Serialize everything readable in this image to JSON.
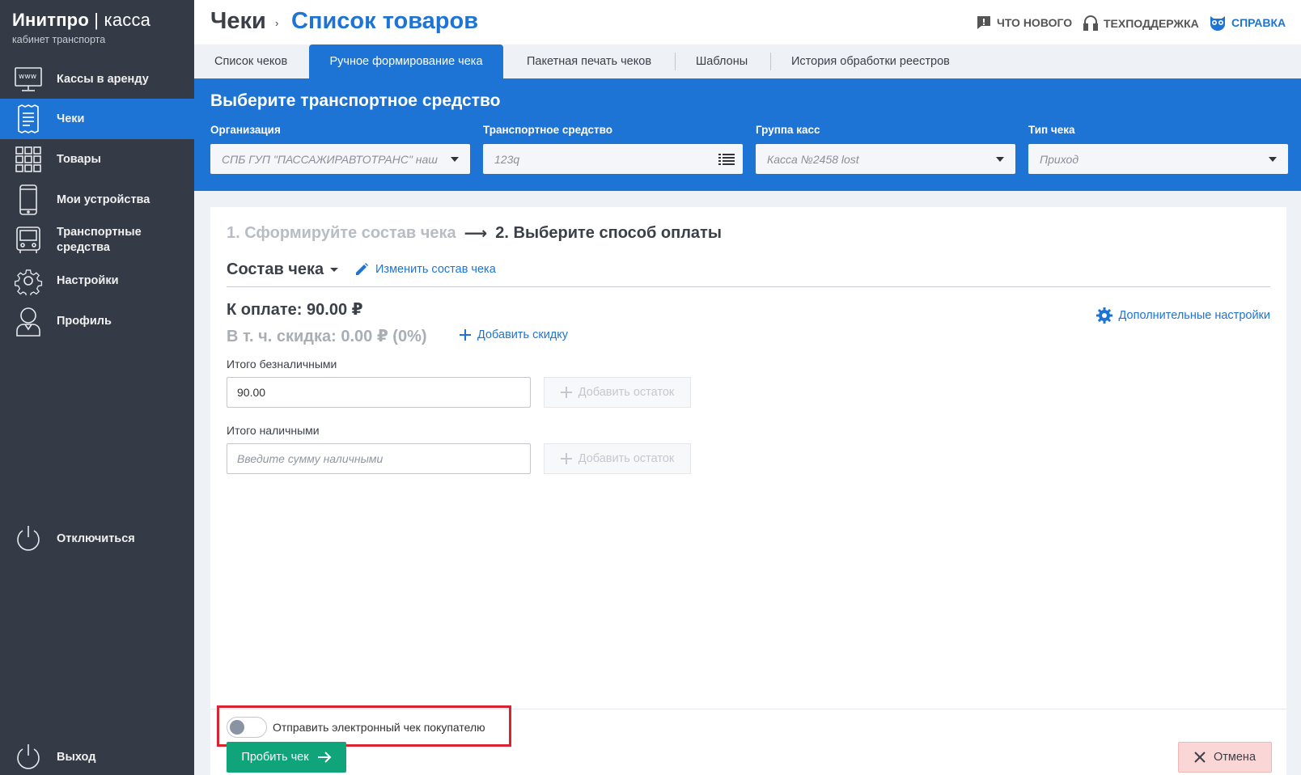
{
  "app": {
    "title_bold": "Инитпро",
    "title_sep": "|",
    "title_thin": "касса",
    "subtitle": "кабинет транспорта"
  },
  "sidebar": {
    "items": [
      {
        "label": "Кассы в аренду",
        "icon": "www-monitor-icon"
      },
      {
        "label": "Чеки",
        "icon": "receipt-icon",
        "active": true
      },
      {
        "label": "Товары",
        "icon": "grid-icon"
      },
      {
        "label": "Мои устройства",
        "icon": "phone-icon"
      },
      {
        "label": "Транспортные средства",
        "icon": "bus-icon"
      },
      {
        "label": "Настройки",
        "icon": "gear-icon"
      },
      {
        "label": "Профиль",
        "icon": "user-icon"
      }
    ],
    "disconnect": "Отключиться",
    "logout": "Выход"
  },
  "header": {
    "breadcrumb_root": "Чеки",
    "breadcrumb_sep": "›",
    "page_title": "Список товаров",
    "whats_new": "ЧТО НОВОГО",
    "support": "ТЕХПОДДЕРЖКА",
    "help": "СПРАВКА"
  },
  "tabs": [
    {
      "label": "Список чеков"
    },
    {
      "label": "Ручное формирование чека",
      "active": true
    },
    {
      "label": "Пакетная печать чеков"
    },
    {
      "label": "Шаблоны"
    },
    {
      "label": "История обработки реестров"
    }
  ],
  "vehicle_select": {
    "title": "Выберите транспортное средство",
    "org_label": "Организация",
    "org_value": "СПБ ГУП \"ПАССАЖИРАВТОТРАНС\" наш",
    "vehicle_label": "Транспортное средство",
    "vehicle_value": "123q",
    "group_label": "Группа касс",
    "group_value": "Касса №2458 lost",
    "type_label": "Тип чека",
    "type_value": "Приход"
  },
  "form": {
    "step1": "1. Сформируйте состав чека",
    "step_arrow": "⟶",
    "step2": "2. Выберите способ оплаты",
    "compose_label": "Состав чека",
    "edit_link": "Изменить состав чека",
    "to_pay": "К оплате: 90.00 ₽",
    "discount": "В т. ч. скидка: 0.00 ₽ (0%)",
    "add_discount": "Добавить скидку",
    "extra_settings": "Дополнительные настройки",
    "cashless_label": "Итого безналичными",
    "cashless_value": "90.00",
    "add_rest": "Добавить остаток",
    "cash_label": "Итого наличными",
    "cash_placeholder": "Введите сумму наличными",
    "send_receipt": "Отправить электронный чек покупателю",
    "send_receipt_on": false,
    "submit": "Пробить чек",
    "cancel": "Отмена"
  },
  "colors": {
    "accent": "#1e74d4",
    "sidebar": "#343a46",
    "success": "#10a47a",
    "highlight": "#d9232e"
  }
}
